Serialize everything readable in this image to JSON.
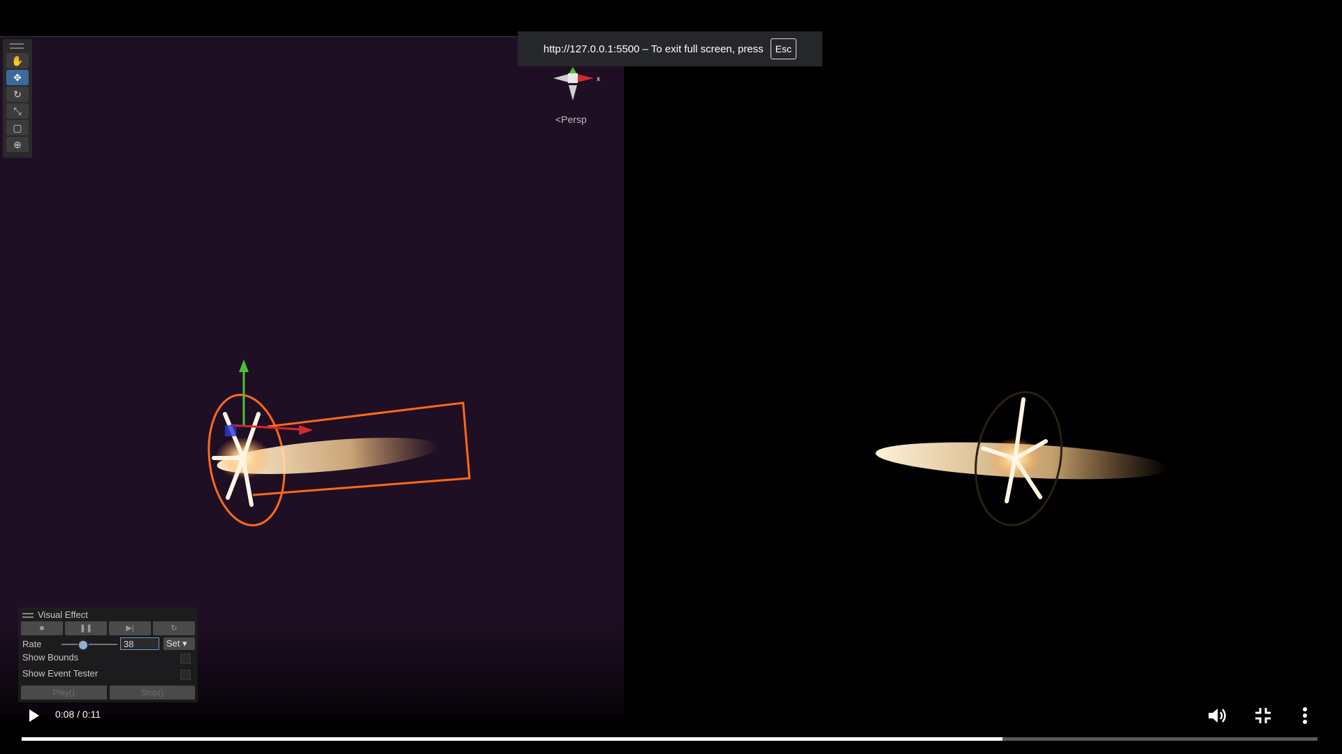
{
  "fullscreen_notice": {
    "text": "http://127.0.0.1:5500 – To exit full screen, press",
    "key": "Esc"
  },
  "scene_view": {
    "projection_label": "Persp",
    "gizmo_axis_label": "x",
    "tools": [
      {
        "name": "hand-tool",
        "icon": "hand-icon",
        "glyph": "✋",
        "active": false
      },
      {
        "name": "move-tool",
        "icon": "move-icon",
        "glyph": "✥",
        "active": true
      },
      {
        "name": "rotate-tool",
        "icon": "rotate-icon",
        "glyph": "↻",
        "active": false
      },
      {
        "name": "scale-tool",
        "icon": "scale-icon",
        "glyph": "⤡",
        "active": false
      },
      {
        "name": "rect-tool",
        "icon": "rect-icon",
        "glyph": "▢",
        "active": false
      },
      {
        "name": "transform-tool",
        "icon": "transform-icon",
        "glyph": "⊕",
        "active": false
      }
    ]
  },
  "visual_effect_panel": {
    "title": "Visual Effect",
    "buttons": [
      {
        "name": "stop",
        "icon": "stop-icon",
        "glyph": "■"
      },
      {
        "name": "pause",
        "icon": "pause-icon",
        "glyph": "❚❚"
      },
      {
        "name": "step",
        "icon": "step-icon",
        "glyph": "▶|"
      },
      {
        "name": "restart",
        "icon": "restart-icon",
        "glyph": "↻"
      }
    ],
    "rate_label": "Rate",
    "rate_value": "38",
    "rate_slider_fraction": 0.3,
    "set_label": "Set ▾",
    "show_bounds_label": "Show Bounds",
    "show_event_tester_label": "Show Event Tester",
    "play_label": "Play()",
    "stop_label": "Stop()"
  },
  "video_controls": {
    "time": "0:08 / 0:11",
    "progress_fraction": 0.757
  },
  "colors": {
    "scene_background": "#1f0f24",
    "selection_outline": "#ff6a1a",
    "axis_x": "#d8262e",
    "axis_y": "#48c232",
    "axis_z": "#2a3bd6",
    "active_tool": "#3d6a9e"
  }
}
